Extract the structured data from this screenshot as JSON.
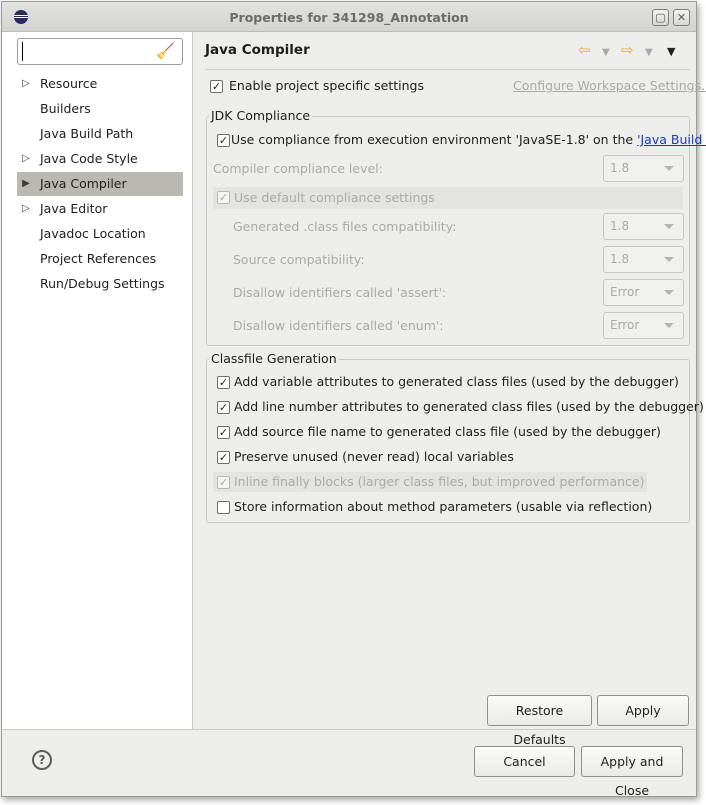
{
  "window": {
    "title": "Properties for 341298_Annotation",
    "minimize_glyph": "▢",
    "close_glyph": "✕"
  },
  "sidebar": {
    "filter_placeholder": "",
    "filter_value": "",
    "clear_icon": "broom-icon",
    "items": [
      {
        "label": "Resource",
        "expandable": true
      },
      {
        "label": "Builders",
        "expandable": false
      },
      {
        "label": "Java Build Path",
        "expandable": false
      },
      {
        "label": "Java Code Style",
        "expandable": true
      },
      {
        "label": "Java Compiler",
        "expandable": true,
        "selected": true
      },
      {
        "label": "Java Editor",
        "expandable": true
      },
      {
        "label": "Javadoc Location",
        "expandable": false
      },
      {
        "label": "Project References",
        "expandable": false
      },
      {
        "label": "Run/Debug Settings",
        "expandable": false
      }
    ]
  },
  "page": {
    "title": "Java Compiler",
    "enable_specific": {
      "label": "Enable project specific settings",
      "checked": true
    },
    "configure_link": "Configure Workspace Settings...",
    "jdk": {
      "group_title": "JDK Compliance",
      "use_env_prefix": "Use compliance from execution environment 'JavaSE-1.8' on the ",
      "use_env_link": "'Java Build Path'",
      "use_env_checked": true,
      "compliance_level_label": "Compiler compliance level:",
      "compliance_level_value": "1.8",
      "use_default_label": "Use default compliance settings",
      "use_default_checked": true,
      "generated_label": "Generated .class files compatibility:",
      "generated_value": "1.8",
      "source_label": "Source compatibility:",
      "source_value": "1.8",
      "assert_label": "Disallow identifiers called 'assert':",
      "assert_value": "Error",
      "enum_label": "Disallow identifiers called 'enum':",
      "enum_value": "Error"
    },
    "classfile": {
      "group_title": "Classfile Generation",
      "options": [
        {
          "label": "Add variable attributes to generated class files (used by the debugger)",
          "checked": true,
          "enabled": true
        },
        {
          "label": "Add line number attributes to generated class files (used by the debugger)",
          "checked": true,
          "enabled": true
        },
        {
          "label": "Add source file name to generated class file (used by the debugger)",
          "checked": true,
          "enabled": true
        },
        {
          "label": "Preserve unused (never read) local variables",
          "checked": true,
          "enabled": true
        },
        {
          "label": "Inline finally blocks (larger class files, but improved performance)",
          "checked": true,
          "enabled": false
        },
        {
          "label": "Store information about method parameters (usable via reflection)",
          "checked": false,
          "enabled": true
        }
      ]
    },
    "restore_defaults": "Restore Defaults",
    "apply": "Apply"
  },
  "footer": {
    "help_glyph": "?",
    "cancel": "Cancel",
    "apply_and_close": "Apply and Close"
  },
  "glyphs": {
    "check": "✓",
    "nav_back": "⇦",
    "nav_forward": "⇨",
    "nav_drop": "▼",
    "view_menu": "▼",
    "twisty_collapsed": "▷",
    "twisty_selected": "▶"
  }
}
